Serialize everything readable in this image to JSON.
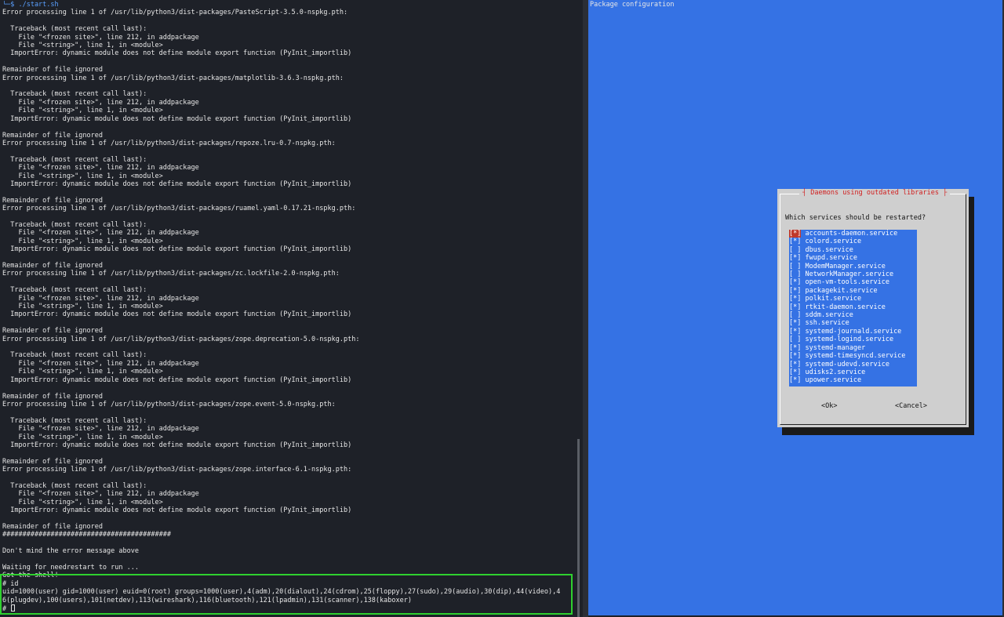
{
  "terminal": {
    "lines": [
      {
        "text": "└─$ ./start.sh",
        "kind": "prompt"
      },
      {
        "text": "Error processing line 1 of /usr/lib/python3/dist-packages/PasteScript-3.5.0-nspkg.pth:"
      },
      {
        "text": ""
      },
      {
        "text": "  Traceback (most recent call last):"
      },
      {
        "text": "    File \"<frozen site>\", line 212, in addpackage"
      },
      {
        "text": "    File \"<string>\", line 1, in <module>"
      },
      {
        "text": "  ImportError: dynamic module does not define module export function (PyInit_importlib)"
      },
      {
        "text": ""
      },
      {
        "text": "Remainder of file ignored"
      },
      {
        "text": "Error processing line 1 of /usr/lib/python3/dist-packages/matplotlib-3.6.3-nspkg.pth:"
      },
      {
        "text": ""
      },
      {
        "text": "  Traceback (most recent call last):"
      },
      {
        "text": "    File \"<frozen site>\", line 212, in addpackage"
      },
      {
        "text": "    File \"<string>\", line 1, in <module>"
      },
      {
        "text": "  ImportError: dynamic module does not define module export function (PyInit_importlib)"
      },
      {
        "text": ""
      },
      {
        "text": "Remainder of file ignored"
      },
      {
        "text": "Error processing line 1 of /usr/lib/python3/dist-packages/repoze.lru-0.7-nspkg.pth:"
      },
      {
        "text": ""
      },
      {
        "text": "  Traceback (most recent call last):"
      },
      {
        "text": "    File \"<frozen site>\", line 212, in addpackage"
      },
      {
        "text": "    File \"<string>\", line 1, in <module>"
      },
      {
        "text": "  ImportError: dynamic module does not define module export function (PyInit_importlib)"
      },
      {
        "text": ""
      },
      {
        "text": "Remainder of file ignored"
      },
      {
        "text": "Error processing line 1 of /usr/lib/python3/dist-packages/ruamel.yaml-0.17.21-nspkg.pth:"
      },
      {
        "text": ""
      },
      {
        "text": "  Traceback (most recent call last):"
      },
      {
        "text": "    File \"<frozen site>\", line 212, in addpackage"
      },
      {
        "text": "    File \"<string>\", line 1, in <module>"
      },
      {
        "text": "  ImportError: dynamic module does not define module export function (PyInit_importlib)"
      },
      {
        "text": ""
      },
      {
        "text": "Remainder of file ignored"
      },
      {
        "text": "Error processing line 1 of /usr/lib/python3/dist-packages/zc.lockfile-2.0-nspkg.pth:"
      },
      {
        "text": ""
      },
      {
        "text": "  Traceback (most recent call last):"
      },
      {
        "text": "    File \"<frozen site>\", line 212, in addpackage"
      },
      {
        "text": "    File \"<string>\", line 1, in <module>"
      },
      {
        "text": "  ImportError: dynamic module does not define module export function (PyInit_importlib)"
      },
      {
        "text": ""
      },
      {
        "text": "Remainder of file ignored"
      },
      {
        "text": "Error processing line 1 of /usr/lib/python3/dist-packages/zope.deprecation-5.0-nspkg.pth:"
      },
      {
        "text": ""
      },
      {
        "text": "  Traceback (most recent call last):"
      },
      {
        "text": "    File \"<frozen site>\", line 212, in addpackage"
      },
      {
        "text": "    File \"<string>\", line 1, in <module>"
      },
      {
        "text": "  ImportError: dynamic module does not define module export function (PyInit_importlib)"
      },
      {
        "text": ""
      },
      {
        "text": "Remainder of file ignored"
      },
      {
        "text": "Error processing line 1 of /usr/lib/python3/dist-packages/zope.event-5.0-nspkg.pth:"
      },
      {
        "text": ""
      },
      {
        "text": "  Traceback (most recent call last):"
      },
      {
        "text": "    File \"<frozen site>\", line 212, in addpackage"
      },
      {
        "text": "    File \"<string>\", line 1, in <module>"
      },
      {
        "text": "  ImportError: dynamic module does not define module export function (PyInit_importlib)"
      },
      {
        "text": ""
      },
      {
        "text": "Remainder of file ignored"
      },
      {
        "text": "Error processing line 1 of /usr/lib/python3/dist-packages/zope.interface-6.1-nspkg.pth:"
      },
      {
        "text": ""
      },
      {
        "text": "  Traceback (most recent call last):"
      },
      {
        "text": "    File \"<frozen site>\", line 212, in addpackage"
      },
      {
        "text": "    File \"<string>\", line 1, in <module>"
      },
      {
        "text": "  ImportError: dynamic module does not define module export function (PyInit_importlib)"
      },
      {
        "text": ""
      },
      {
        "text": "Remainder of file ignored"
      },
      {
        "text": "##########################################"
      },
      {
        "text": ""
      },
      {
        "text": "Don't mind the error message above"
      },
      {
        "text": ""
      },
      {
        "text": "Waiting for needrestart to run ..."
      },
      {
        "text": "Got the shell!"
      },
      {
        "text": "# id"
      },
      {
        "text": "uid=1000(user) gid=1000(user) euid=0(root) groups=1000(user),4(adm),20(dialout),24(cdrom),25(floppy),27(sudo),29(audio),30(dip),44(video),4"
      },
      {
        "text": "6(plugdev),100(users),101(netdev),113(wireshark),116(bluetooth),121(lpadmin),131(scanner),138(kaboxer)"
      },
      {
        "text": "# ",
        "kind": "cursor"
      }
    ]
  },
  "package_config": {
    "title": "Package configuration",
    "dialog": {
      "title": "Daemons using outdated libraries",
      "question": "Which services should be restarted?",
      "services": [
        {
          "check": "[*]",
          "name": "accounts-daemon.service"
        },
        {
          "check": "[*]",
          "name": "colord.service"
        },
        {
          "check": "[ ]",
          "name": "dbus.service"
        },
        {
          "check": "[*]",
          "name": "fwupd.service"
        },
        {
          "check": "[ ]",
          "name": "ModemManager.service"
        },
        {
          "check": "[ ]",
          "name": "NetworkManager.service"
        },
        {
          "check": "[*]",
          "name": "open-vm-tools.service"
        },
        {
          "check": "[*]",
          "name": "packagekit.service"
        },
        {
          "check": "[*]",
          "name": "polkit.service"
        },
        {
          "check": "[*]",
          "name": "rtkit-daemon.service"
        },
        {
          "check": "[ ]",
          "name": "sddm.service"
        },
        {
          "check": "[*]",
          "name": "ssh.service"
        },
        {
          "check": "[*]",
          "name": "systemd-journald.service"
        },
        {
          "check": "[ ]",
          "name": "systemd-logind.service"
        },
        {
          "check": "[*]",
          "name": "systemd-manager"
        },
        {
          "check": "[*]",
          "name": "systemd-timesyncd.service"
        },
        {
          "check": "[*]",
          "name": "systemd-udevd.service"
        },
        {
          "check": "[*]",
          "name": "udisks2.service"
        },
        {
          "check": "[*]",
          "name": "upower.service"
        }
      ],
      "ok_label": "<Ok>",
      "cancel_label": "<Cancel>"
    }
  },
  "colors": {
    "terminal_bg": "#1e2128",
    "dialog_bg": "#3572e4",
    "highlight_border": "#2fd12f",
    "dialog_title": "#d02020"
  }
}
